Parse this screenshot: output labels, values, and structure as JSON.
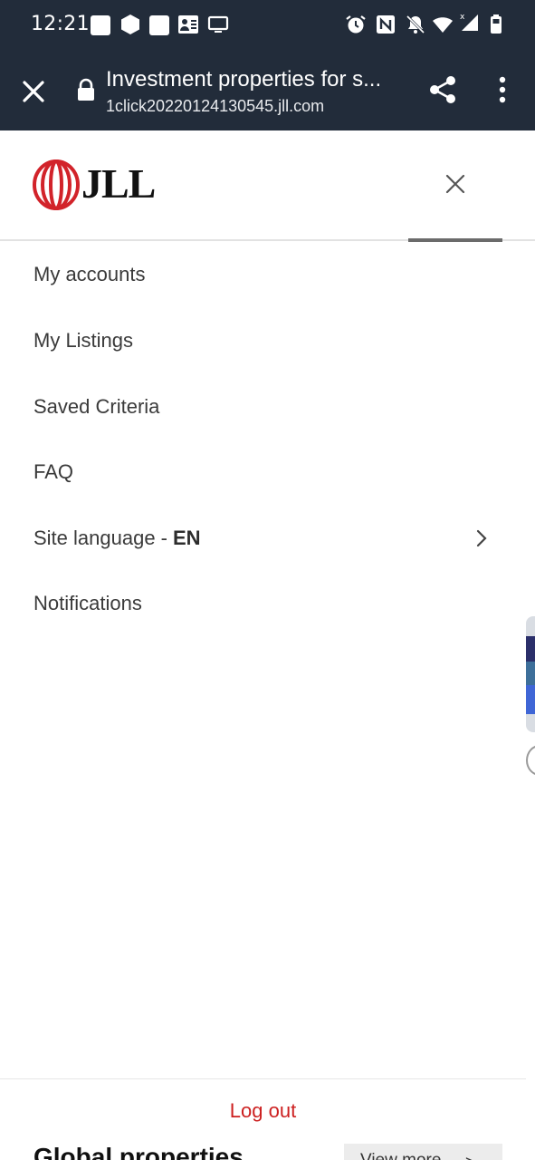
{
  "status_bar": {
    "time": "12:21",
    "left_icons": [
      "app-square-icon",
      "hexagon-icon",
      "app-square-icon",
      "contacts-icon",
      "cast-screen-icon"
    ],
    "right_icons": [
      "alarm-icon",
      "nfc-icon",
      "mute-icon",
      "wifi-icon",
      "signal-icon",
      "battery-icon"
    ]
  },
  "browser": {
    "title": "Investment properties for s...",
    "url": "1click20220124130545.jll.com"
  },
  "header": {
    "logo_text": "JLL",
    "brand_color": "#d2232a"
  },
  "menu": {
    "items": [
      {
        "label": "My accounts"
      },
      {
        "label": "My Listings"
      },
      {
        "label": "Saved Criteria"
      },
      {
        "label": "FAQ"
      },
      {
        "label": "Site language -",
        "value": "EN"
      },
      {
        "label": "Notifications"
      }
    ]
  },
  "footer": {
    "logout_label": "Log out",
    "section_title": "Global properties",
    "view_more_label": "View more"
  },
  "colors": {
    "toolbar_bg": "#222c3a",
    "logout": "#cc1f1f"
  }
}
